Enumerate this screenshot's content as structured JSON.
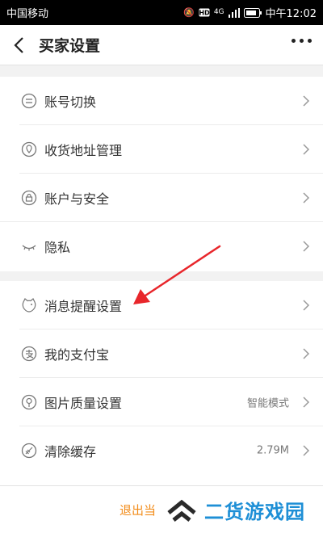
{
  "status_bar": {
    "carrier": "中国移动",
    "network": "4G",
    "clock": "中午12:02"
  },
  "header": {
    "title": "买家设置"
  },
  "groups": [
    {
      "items": [
        {
          "label": "账号切换",
          "value": ""
        },
        {
          "label": "收货地址管理",
          "value": ""
        },
        {
          "label": "账户与安全",
          "value": ""
        },
        {
          "label": "隐私",
          "value": ""
        }
      ]
    },
    {
      "items": [
        {
          "label": "消息提醒设置",
          "value": ""
        },
        {
          "label": "我的支付宝",
          "value": ""
        },
        {
          "label": "图片质量设置",
          "value": "智能模式"
        },
        {
          "label": "清除缓存",
          "value": "2.79M"
        }
      ]
    }
  ],
  "footer": {
    "logout_label": "退出当"
  },
  "watermark": {
    "text": "二货游戏园"
  },
  "colors": {
    "annotation_arrow": "#e8262b",
    "logout": "#f28c1a",
    "watermark": "#1e8fd6"
  }
}
